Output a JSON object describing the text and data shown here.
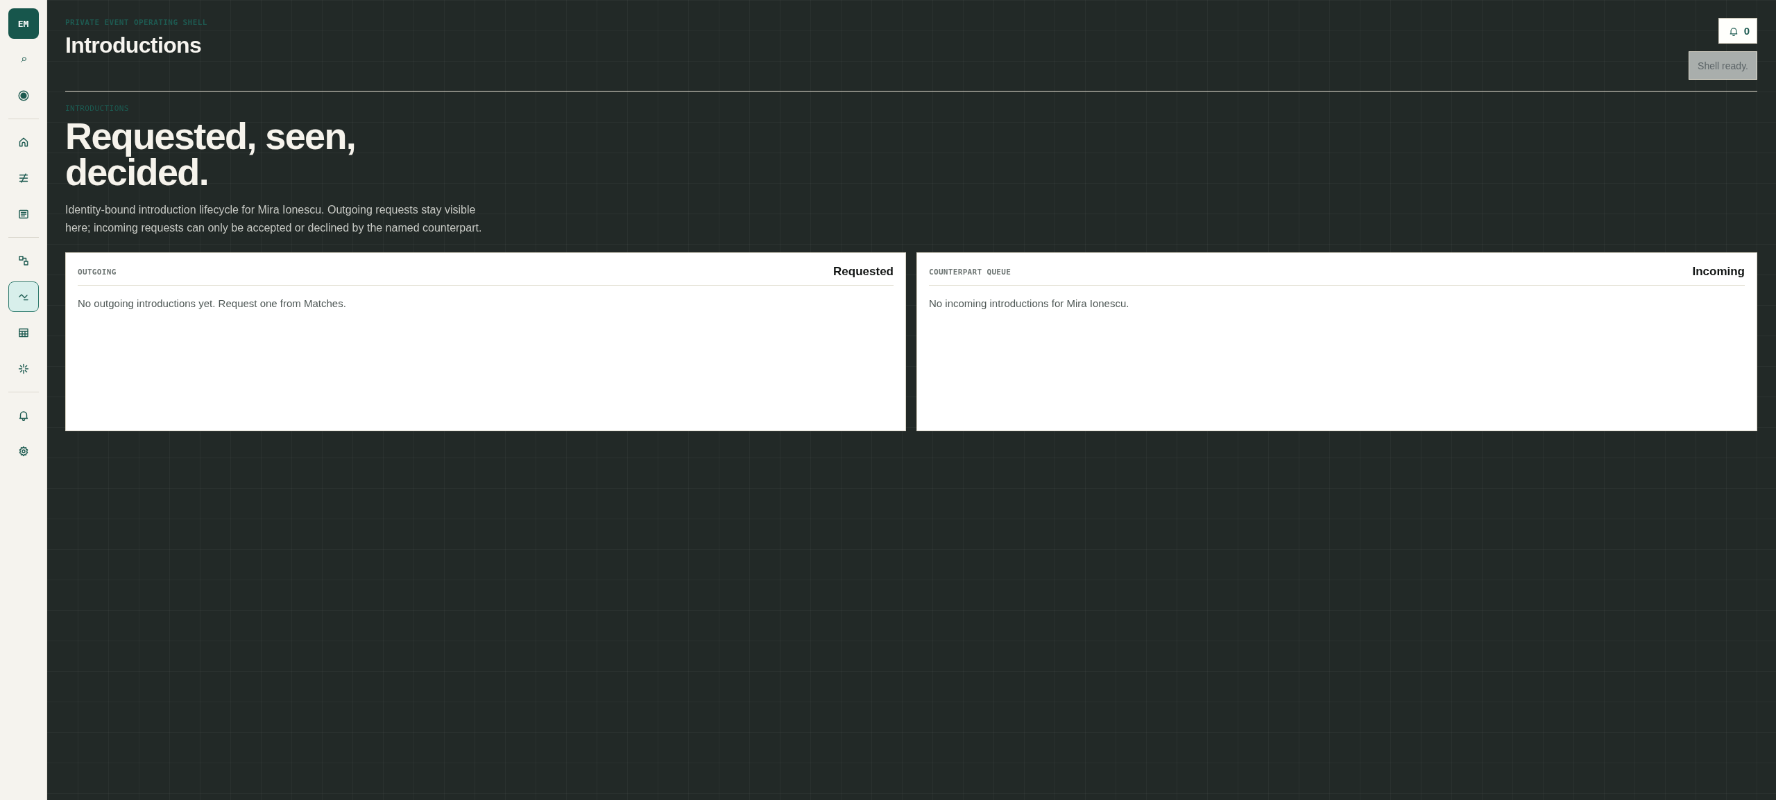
{
  "sidebar": {
    "avatar": "EM",
    "groups": [
      {
        "items": [
          {
            "kind": "search",
            "selected": false
          },
          {
            "kind": "target",
            "selected": false
          }
        ]
      },
      {
        "items": [
          {
            "kind": "home",
            "selected": false
          },
          {
            "kind": "strike",
            "selected": false
          },
          {
            "kind": "document",
            "selected": false
          }
        ]
      },
      {
        "items": [
          {
            "kind": "nodes",
            "selected": false
          },
          {
            "kind": "trend",
            "selected": true
          },
          {
            "kind": "table",
            "selected": false
          },
          {
            "kind": "sparkle",
            "selected": false
          }
        ]
      },
      {
        "items": [
          {
            "kind": "bell",
            "selected": false
          },
          {
            "kind": "settings",
            "selected": false
          }
        ]
      }
    ]
  },
  "header": {
    "eyebrow": "PRIVATE EVENT OPERATING SHELL",
    "title": "Introductions",
    "notifications": {
      "count": "0"
    },
    "status": "Shell ready."
  },
  "hero": {
    "eyebrow": "INTRODUCTIONS",
    "headline": "Requested, seen, decided.",
    "description": "Identity-bound introduction lifecycle for Mira Ionescu. Outgoing requests stay visible here; incoming requests can only be accepted or declined by the named counterpart."
  },
  "panels": [
    {
      "eyebrow": "OUTGOING",
      "title": "Requested",
      "message": "No outgoing introductions yet. Request one from Matches."
    },
    {
      "eyebrow": "COUNTERPART QUEUE",
      "title": "Incoming",
      "message": "No incoming introductions for Mira Ionescu."
    }
  ]
}
